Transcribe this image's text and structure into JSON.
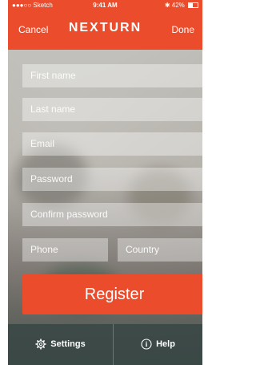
{
  "statusbar": {
    "carrier": "●●●○○ Sketch",
    "time": "9:41 AM",
    "battery": "42%"
  },
  "navbar": {
    "cancel": "Cancel",
    "title": "NEXTURN",
    "done": "Done"
  },
  "form": {
    "first_name": "First name",
    "last_name": "Last name",
    "email": "Email",
    "password": "Password",
    "confirm_password": "Confirm password",
    "phone": "Phone",
    "country": "Country"
  },
  "register_label": "Register",
  "tabs": {
    "settings": "Settings",
    "help": "Help"
  },
  "colors": {
    "accent": "#ea4c2c",
    "tabbar": "#374644"
  }
}
